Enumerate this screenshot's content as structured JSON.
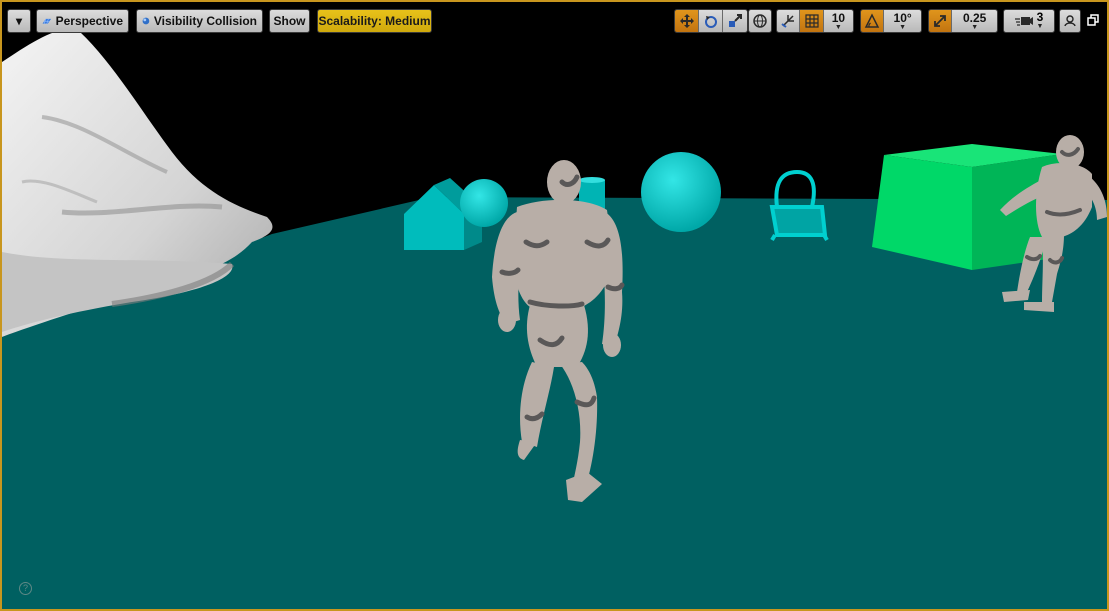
{
  "toolbar": {
    "menu_caret": "▾",
    "perspective_label": "Perspective",
    "view_mode_label": "Visibility Collision",
    "show_label": "Show",
    "scalability_label": "Scalability: Medium",
    "grid_snap_value": "10",
    "rotation_snap_value": "10°",
    "scale_snap_value": "0.25",
    "camera_speed_value": "3"
  },
  "help_glyph": "?",
  "colors": {
    "viewport_border": "#c8961e",
    "ground": "#006061",
    "sky": "#000000",
    "cyan_object": "#00c9c9",
    "mannequin": "#b6ada6",
    "green_cube": "#00d060",
    "active_toggle": "#e0951c",
    "scalability_badge": "#e8c21a"
  }
}
